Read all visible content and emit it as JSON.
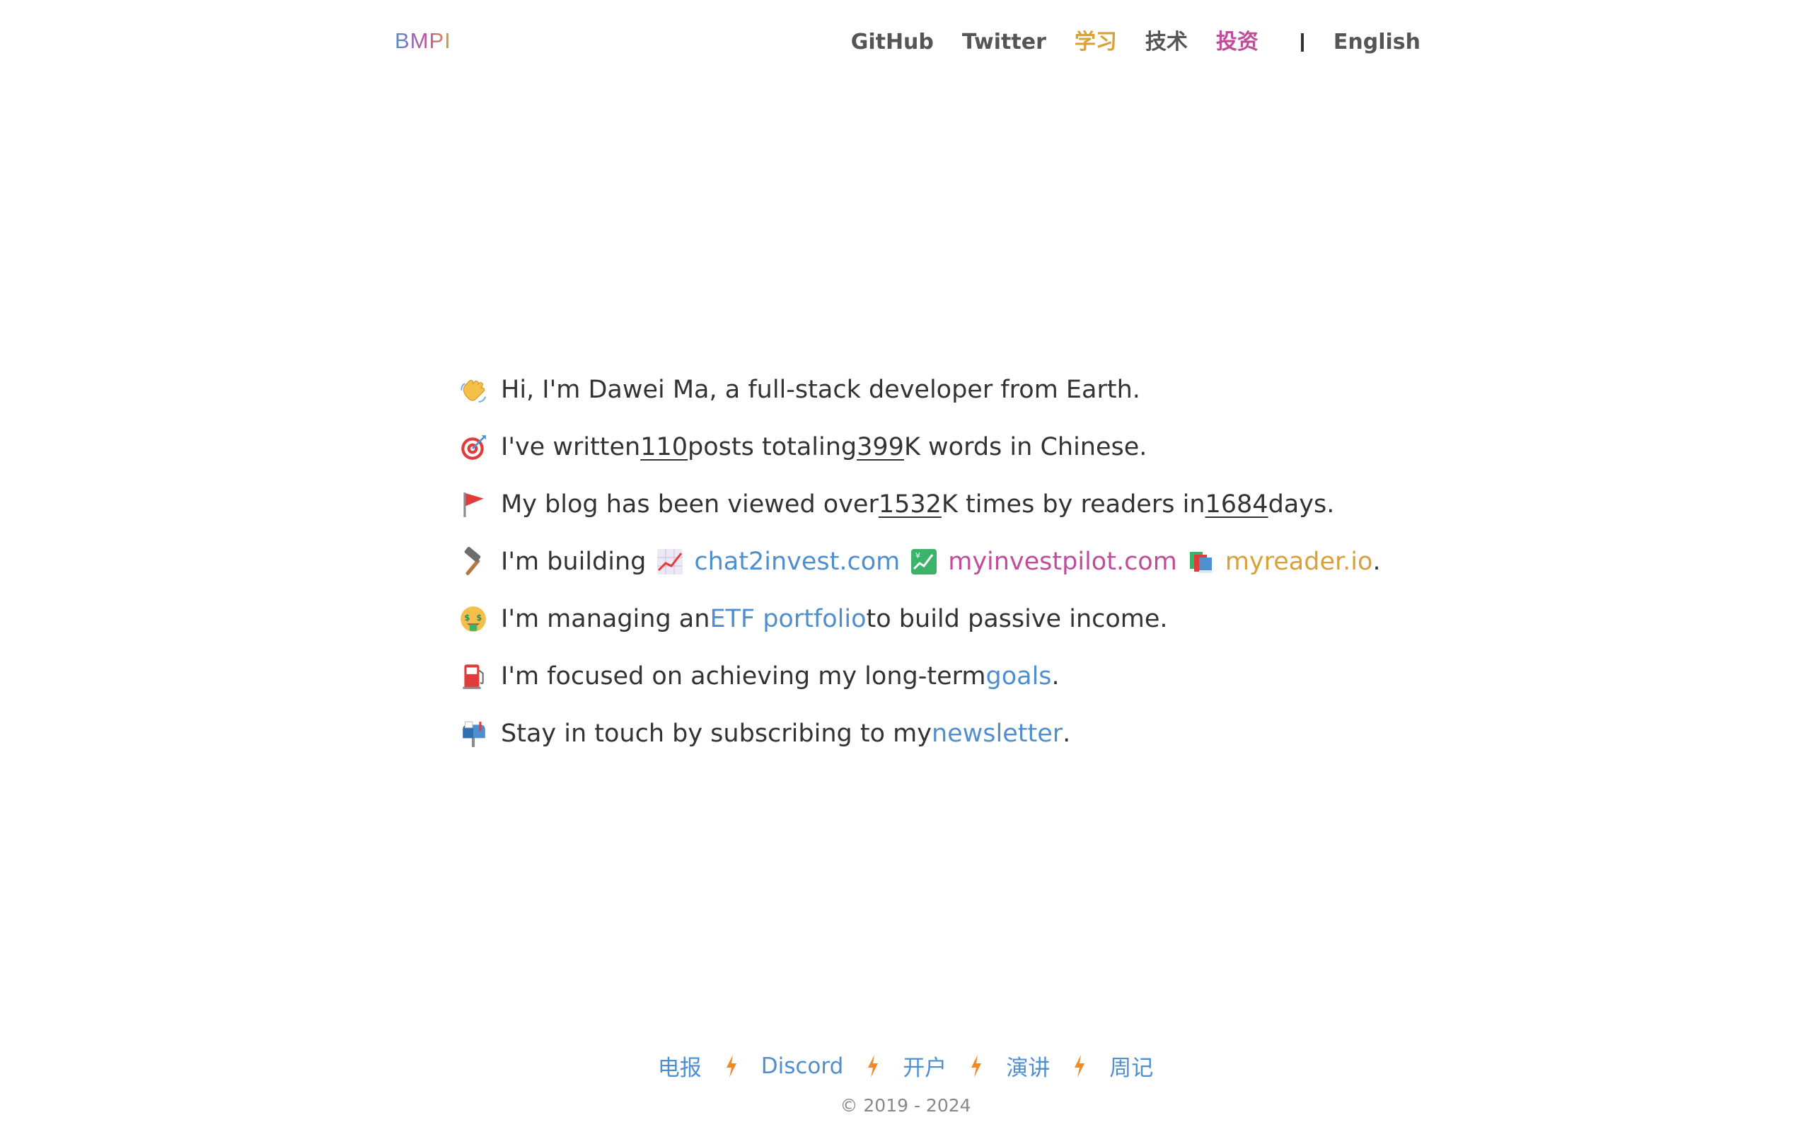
{
  "header": {
    "logo": "BMPI",
    "nav": {
      "github": "GitHub",
      "twitter": "Twitter",
      "learn": "学习",
      "tech": "技术",
      "invest": "投资",
      "language": "English"
    }
  },
  "intro": {
    "line1": {
      "icon": "waving-hand-icon",
      "text": "Hi, I'm Dawei Ma, a full-stack developer from Earth."
    },
    "line2": {
      "icon": "target-icon",
      "prefix": "I've written ",
      "posts": "110",
      "middle": " posts totaling ",
      "words": "399",
      "suffix": "K words in Chinese."
    },
    "line3": {
      "icon": "red-flag-icon",
      "prefix": "My blog has been viewed over ",
      "views": "1532",
      "middle": "K times by readers in ",
      "days": "1684",
      "suffix": " days."
    },
    "line4": {
      "icon": "hammer-icon",
      "prefix": "I'm building ",
      "project1": "chat2invest.com",
      "project1_icon": "chart-increasing-icon",
      "project2": "myinvestpilot.com",
      "project2_icon": "yen-chart-icon",
      "project3": "myreader.io",
      "project3_icon": "books-icon",
      "suffix": "."
    },
    "line5": {
      "icon": "money-mouth-face-icon",
      "prefix": "I'm managing an ",
      "link": "ETF portfolio",
      "suffix": " to build passive income."
    },
    "line6": {
      "icon": "fuel-pump-icon",
      "prefix": "I'm focused on achieving my long-term ",
      "link": "goals",
      "suffix": "."
    },
    "line7": {
      "icon": "mailbox-icon",
      "prefix": "Stay in touch by subscribing to my ",
      "link": "newsletter",
      "suffix": "."
    }
  },
  "footer": {
    "links": [
      "电报",
      "Discord",
      "开户",
      "演讲",
      "周记"
    ],
    "separator_icon": "lightning-bolt-icon",
    "copyright": "© 2019 - 2024"
  },
  "colors": {
    "blue": "#4f8fd0",
    "pink": "#c04d9c",
    "gold": "#d8a13c",
    "text": "#333333",
    "bolt": "#f08a24"
  }
}
